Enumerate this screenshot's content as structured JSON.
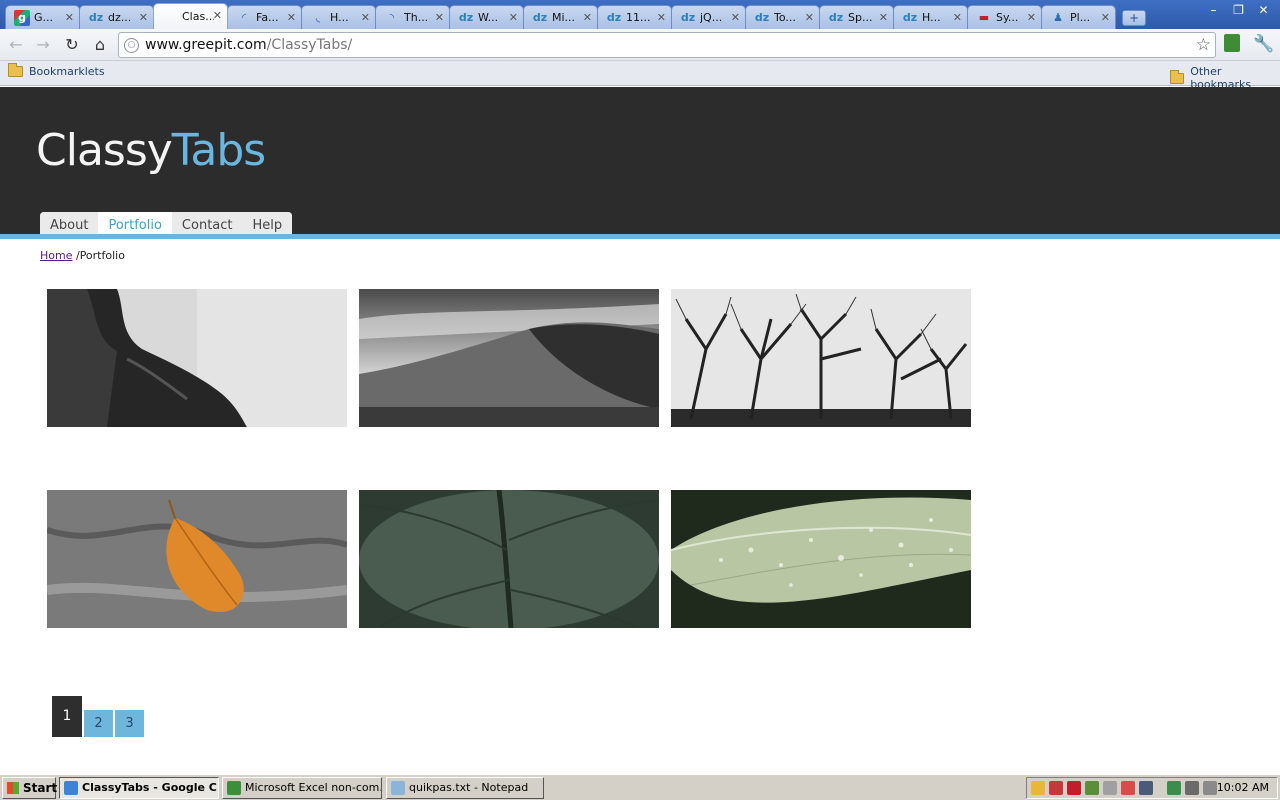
{
  "browser": {
    "tabs": [
      {
        "title": "G...",
        "icon": "google-icon",
        "icon_char": "g",
        "active": false
      },
      {
        "title": "dz...",
        "icon": "dzone-icon",
        "icon_char": "dz",
        "active": false
      },
      {
        "title": "Clas...",
        "icon": "page-icon",
        "icon_char": "",
        "active": true
      },
      {
        "title": "Fa...",
        "icon": "loading-icon",
        "icon_char": "◜",
        "active": false
      },
      {
        "title": "H...",
        "icon": "loading-icon",
        "icon_char": "◟",
        "active": false
      },
      {
        "title": "Th...",
        "icon": "loading-icon",
        "icon_char": "◝",
        "active": false
      },
      {
        "title": "W...",
        "icon": "dzone-icon",
        "icon_char": "dz",
        "active": false
      },
      {
        "title": "Mi...",
        "icon": "dzone-icon",
        "icon_char": "dz",
        "active": false
      },
      {
        "title": "11...",
        "icon": "dzone-icon",
        "icon_char": "dz",
        "active": false
      },
      {
        "title": "jQ...",
        "icon": "dzone-icon",
        "icon_char": "dz",
        "active": false
      },
      {
        "title": "To...",
        "icon": "dzone-icon",
        "icon_char": "dz",
        "active": false
      },
      {
        "title": "Sp...",
        "icon": "dzone-icon",
        "icon_char": "dz",
        "active": false
      },
      {
        "title": "H...",
        "icon": "dzone-icon",
        "icon_char": "dz",
        "active": false
      },
      {
        "title": "Sy...",
        "icon": "site-icon",
        "icon_char": "▬",
        "active": false
      },
      {
        "title": "Pl...",
        "icon": "playstation-icon",
        "icon_char": "♟",
        "active": false
      }
    ],
    "new_tab_label": "+",
    "url_host": "www.greepit.com",
    "url_path": "/ClassyTabs/",
    "bookmarks_left": "Bookmarklets",
    "bookmarks_right": "Other bookmarks"
  },
  "site": {
    "logo_white": "Classy",
    "logo_blue": "Tabs",
    "nav": [
      {
        "label": "About",
        "active": false
      },
      {
        "label": "Portfolio",
        "active": true
      },
      {
        "label": "Contact",
        "active": false
      },
      {
        "label": "Help",
        "active": false
      }
    ],
    "breadcrumb": {
      "home": "Home",
      "current": "/Portfolio"
    },
    "pagination": [
      "1",
      "2",
      "3"
    ],
    "current_page": "1"
  },
  "taskbar": {
    "start_label": "Start",
    "tasks": [
      {
        "label": "ClassyTabs - Google C...",
        "active": true,
        "icon_color": "#3f83d6"
      },
      {
        "label": "Microsoft Excel non-com...",
        "active": false,
        "icon_color": "#3b8f3b"
      },
      {
        "label": "quikpas.txt - Notepad",
        "active": false,
        "icon_color": "#8cb4d8"
      }
    ],
    "clock": "10:02 AM"
  },
  "colors": {
    "accent_blue": "#69b6e0",
    "header_dark": "#2c2c2c"
  }
}
